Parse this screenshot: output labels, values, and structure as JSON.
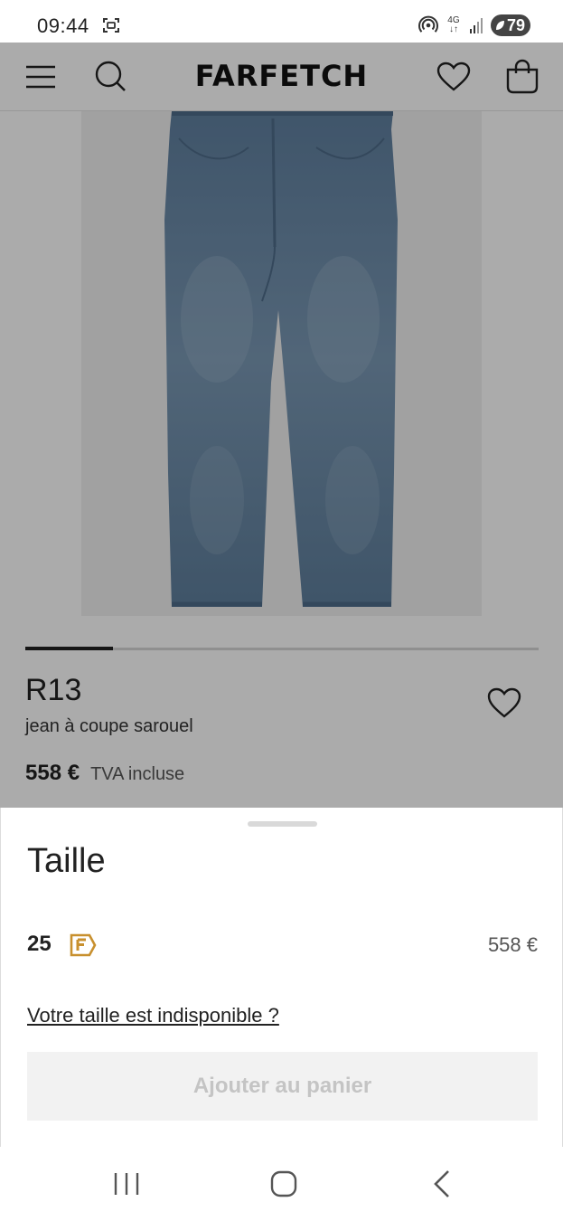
{
  "status_bar": {
    "time": "09:44",
    "network": "4G",
    "battery": "79"
  },
  "app_bar": {
    "logo": "FARFETCH",
    "menu_icon": "menu-icon",
    "search_icon": "search-icon",
    "wishlist_icon": "heart-icon",
    "bag_icon": "bag-icon"
  },
  "product": {
    "image": "blue-denim-jeans-photo",
    "carousel_progress": 0.17,
    "brand": "R13",
    "name": "jean à coupe sarouel",
    "price": "558 €",
    "vat_note": "TVA incluse"
  },
  "size_sheet": {
    "title": "Taille",
    "options": [
      {
        "size": "25",
        "badge_icon": "farfetch-f-badge-icon",
        "price": "558 €"
      }
    ],
    "unavailable_link": "Votre taille est indisponible ?",
    "add_to_cart": "Ajouter au panier"
  },
  "colors": {
    "badge": "#C8902E",
    "denim": "#6E8FAD",
    "button_bg": "#F2F2F2",
    "button_text": "#C4C4C4"
  }
}
